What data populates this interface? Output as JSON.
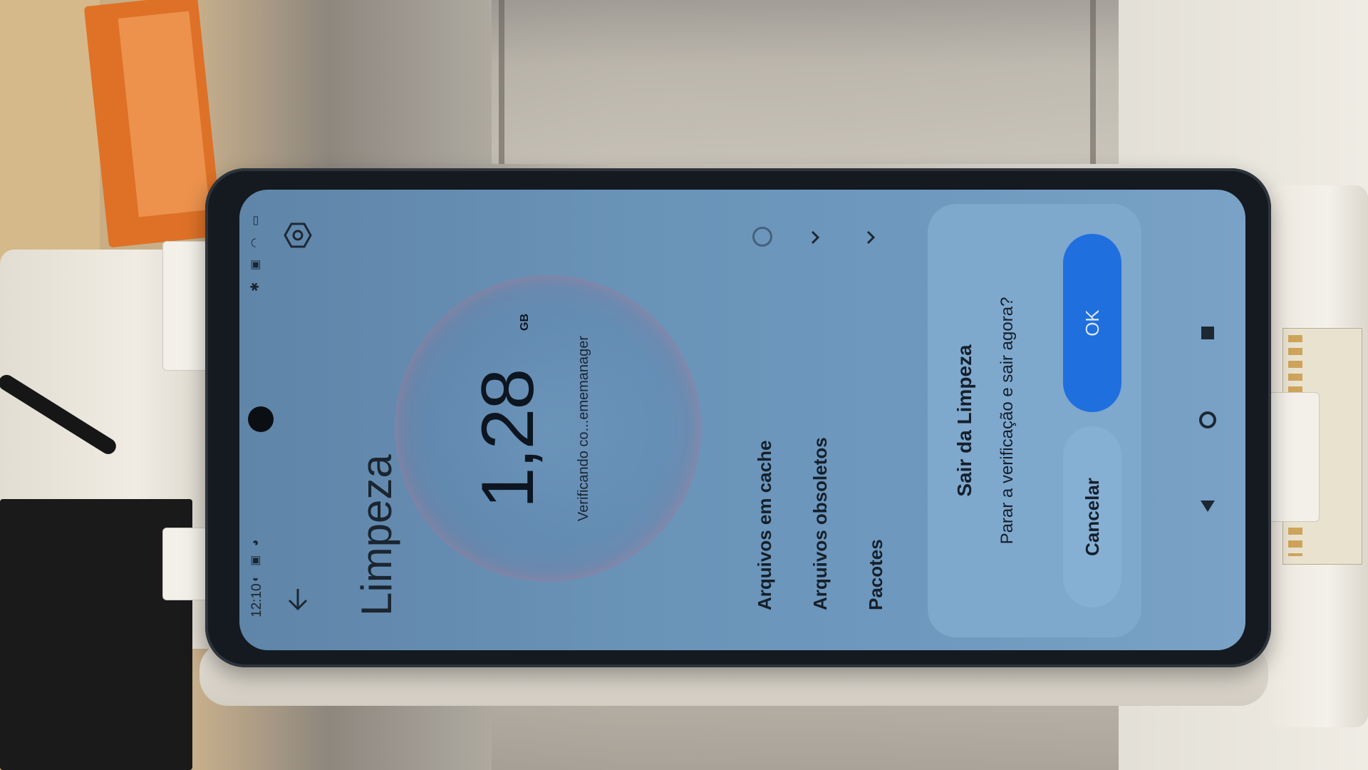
{
  "status_bar": {
    "time": "12:10",
    "left_icons": "◐ ▣ ◕",
    "right_icons": "✱ ▣ ◠ ▭"
  },
  "header": {
    "title": "Limpeza",
    "back_icon": "arrow-back-icon",
    "settings_icon": "settings-hexagon-icon"
  },
  "scan": {
    "size_value": "1,28",
    "size_unit": "GB",
    "status_text": "Verificando co...ememanager"
  },
  "categories": [
    {
      "label": "Arquivos em cache",
      "state": "spinner"
    },
    {
      "label": "Arquivos obsoletos",
      "state": "chevron"
    },
    {
      "label": "Pacotes",
      "state": "chevron"
    }
  ],
  "dialog": {
    "title": "Sair da Limpeza",
    "message": "Parar a verificação e sair agora?",
    "cancel_label": "Cancelar",
    "ok_label": "OK"
  },
  "colors": {
    "screen_blue": "#6a93b8",
    "ok_button": "#1f6fde",
    "dialog_bg": "#7fa8cd"
  }
}
